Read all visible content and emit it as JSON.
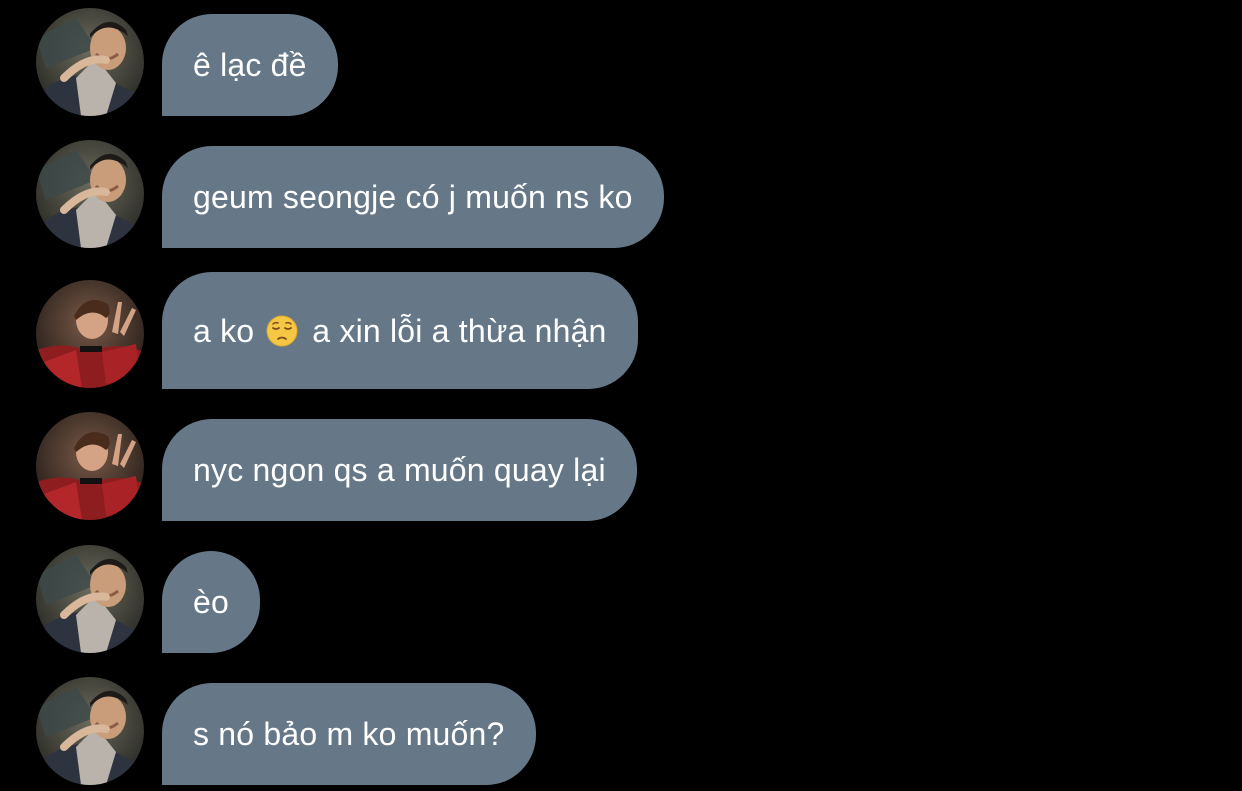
{
  "conversation": {
    "messages": [
      {
        "avatar": "avatar-boy-1",
        "text": "ê lạc đề"
      },
      {
        "avatar": "avatar-boy-1",
        "text": "geum seongje có j muốn ns ko"
      },
      {
        "avatar": "avatar-boy-2",
        "text_before": "a ko",
        "emoji": "pensive-face-icon",
        "text_after": "a xin lỗi a thừa nhận"
      },
      {
        "avatar": "avatar-boy-2",
        "text": "nyc ngon qs a muốn quay lại"
      },
      {
        "avatar": "avatar-boy-1",
        "text": "èo"
      },
      {
        "avatar": "avatar-boy-1",
        "text": "s nó bảo m ko muốn?"
      }
    ]
  },
  "colors": {
    "background": "#000000",
    "bubble": "#667888",
    "text": "#ffffff"
  }
}
